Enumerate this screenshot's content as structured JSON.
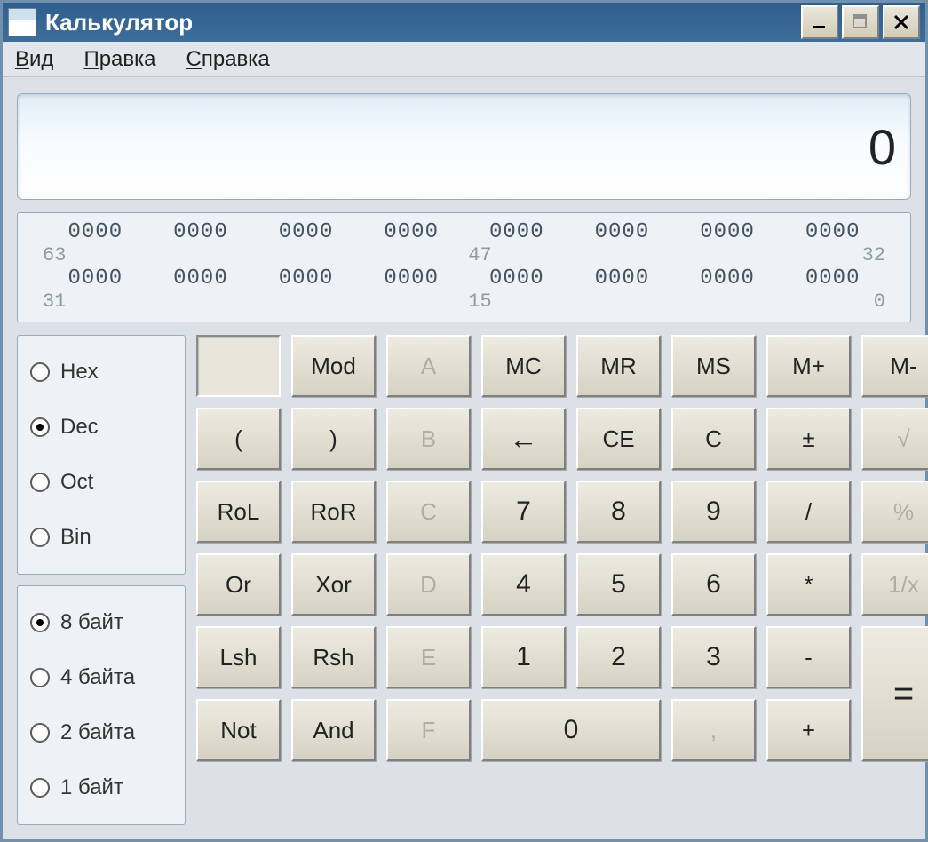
{
  "window": {
    "title": "Калькулятор"
  },
  "menu": {
    "view": "Вид",
    "edit": "Правка",
    "help": "Справка"
  },
  "display": {
    "value": "0"
  },
  "bits": {
    "row1": [
      "0000",
      "0000",
      "0000",
      "0000",
      "0000",
      "0000",
      "0000",
      "0000"
    ],
    "idx1": {
      "l": "63",
      "m": "47",
      "r": "32"
    },
    "row2": [
      "0000",
      "0000",
      "0000",
      "0000",
      "0000",
      "0000",
      "0000",
      "0000"
    ],
    "idx2": {
      "l": "31",
      "m": "15",
      "r": "0"
    }
  },
  "radix": {
    "hex": "Hex",
    "dec": "Dec",
    "oct": "Oct",
    "bin": "Bin",
    "selected": "dec"
  },
  "word": {
    "b8": "8 байт",
    "b4": "4 байта",
    "b2": "2 байта",
    "b1": "1 байт",
    "selected": "b8"
  },
  "keys": {
    "mod": "Mod",
    "a": "A",
    "mc": "MC",
    "mr": "MR",
    "ms": "MS",
    "mplus": "M+",
    "mminus": "M-",
    "lp": "(",
    "rp": ")",
    "b": "B",
    "ce": "CE",
    "c": "C",
    "pm": "±",
    "sqrt": "√",
    "rol": "RoL",
    "ror": "RoR",
    "cc": "C",
    "n7": "7",
    "n8": "8",
    "n9": "9",
    "div": "/",
    "pct": "%",
    "or": "Or",
    "xor": "Xor",
    "d": "D",
    "n4": "4",
    "n5": "5",
    "n6": "6",
    "mul": "*",
    "inv": "1/x",
    "lsh": "Lsh",
    "rsh": "Rsh",
    "e": "E",
    "n1": "1",
    "n2": "2",
    "n3": "3",
    "minus": "-",
    "not": "Not",
    "and": "And",
    "f": "F",
    "n0": "0",
    "dot": ",",
    "plus": "+",
    "eq": "="
  }
}
